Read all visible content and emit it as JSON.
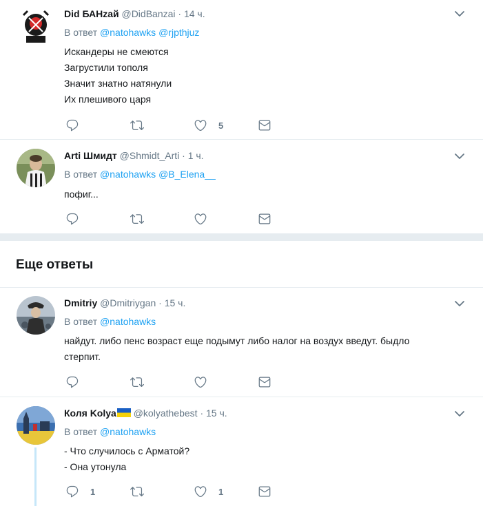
{
  "tweets": [
    {
      "fullname": "Did БАНzай",
      "handle": "@DidBanzai",
      "time": "14 ч.",
      "reply_prefix": "В ответ",
      "reply_to": [
        "@natohawks",
        "@rjpthjuz"
      ],
      "lines": [
        "Искандеры не смеются",
        "Загрустили тополя",
        "Значит знатно натянули",
        "Их плешивого царя"
      ],
      "reply_count": "",
      "retweet_count": "",
      "like_count": "5"
    },
    {
      "fullname": "Arti Шмидт",
      "handle": "@Shmidt_Arti",
      "time": "1 ч.",
      "reply_prefix": "В ответ",
      "reply_to": [
        "@natohawks",
        "@B_Elena__"
      ],
      "lines": [
        "пофиг..."
      ],
      "reply_count": "",
      "retweet_count": "",
      "like_count": ""
    },
    {
      "fullname": "Dmitriy",
      "handle": "@Dmitriygan",
      "time": "15 ч.",
      "reply_prefix": "В ответ",
      "reply_to": [
        "@natohawks"
      ],
      "lines": [
        "найдут. либо пенс возраст еще подымут либо налог на воздух введут. быдло",
        "стерпит."
      ],
      "reply_count": "",
      "retweet_count": "",
      "like_count": ""
    },
    {
      "fullname": "Коля Kolya",
      "handle": "@kolyathebest",
      "time": "15 ч.",
      "reply_prefix": "В ответ",
      "reply_to": [
        "@natohawks"
      ],
      "lines": [
        "- Что случилось с Арматой?",
        "- Она утонула"
      ],
      "reply_count": "1",
      "retweet_count": "",
      "like_count": "1"
    }
  ],
  "more_replies_title": "Еще ответы",
  "separator": "·",
  "icons": {
    "reply": "reply-icon",
    "retweet": "retweet-icon",
    "like": "heart-icon",
    "dm": "envelope-icon",
    "caret": "chevron-down-icon"
  },
  "colors": {
    "link": "#1da1f2",
    "muted": "#657786",
    "text": "#14171a",
    "divider": "#e6ecf0"
  }
}
